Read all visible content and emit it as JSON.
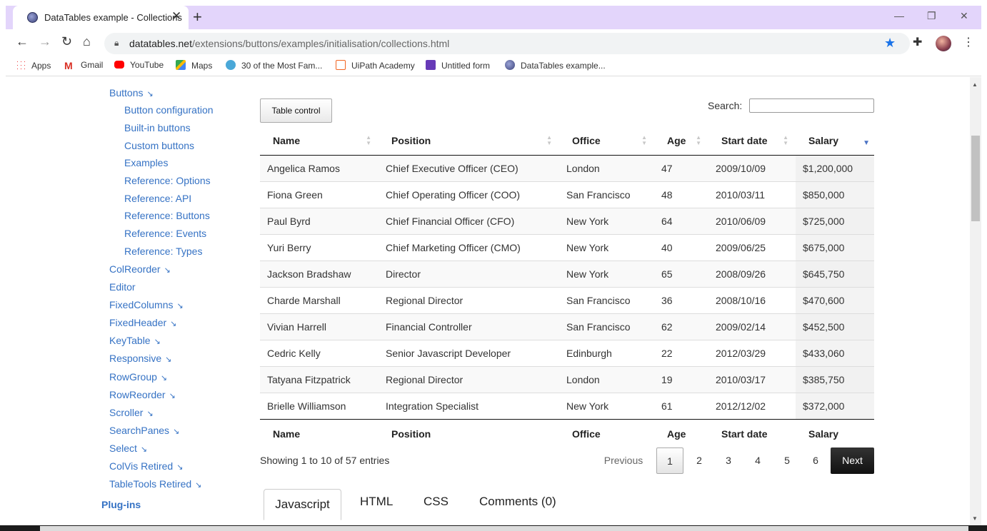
{
  "browser": {
    "tab_title": "DataTables example - Collections",
    "tab_close": "✕",
    "new_tab": "+",
    "url_host": "datatables.net",
    "url_path": "/extensions/buttons/examples/initialisation/collections.html",
    "bookmarks": [
      "Apps",
      "Gmail",
      "YouTube",
      "Maps",
      "30 of the Most Fam...",
      "UiPath Academy",
      "Untitled form",
      "DataTables example..."
    ]
  },
  "sidebar": {
    "items": [
      {
        "label": "Buttons",
        "arrow": "↘"
      },
      {
        "label": "Button configuration"
      },
      {
        "label": "Built-in buttons"
      },
      {
        "label": "Custom buttons"
      },
      {
        "label": "Examples"
      },
      {
        "label": "Reference: Options"
      },
      {
        "label": "Reference: API"
      },
      {
        "label": "Reference: Buttons"
      },
      {
        "label": "Reference: Events"
      },
      {
        "label": "Reference: Types"
      },
      {
        "label": "ColReorder",
        "arrow": "↘"
      },
      {
        "label": "Editor"
      },
      {
        "label": "FixedColumns",
        "arrow": "↘"
      },
      {
        "label": "FixedHeader",
        "arrow": "↘"
      },
      {
        "label": "KeyTable",
        "arrow": "↘"
      },
      {
        "label": "Responsive",
        "arrow": "↘"
      },
      {
        "label": "RowGroup",
        "arrow": "↘"
      },
      {
        "label": "RowReorder",
        "arrow": "↘"
      },
      {
        "label": "Scroller",
        "arrow": "↘"
      },
      {
        "label": "SearchPanes",
        "arrow": "↘"
      },
      {
        "label": "Select",
        "arrow": "↘"
      },
      {
        "label": "ColVis Retired",
        "arrow": "↘"
      },
      {
        "label": "TableTools Retired",
        "arrow": "↘"
      }
    ],
    "plugins_heading": "Plug-ins"
  },
  "controls": {
    "table_control_label": "Table control",
    "search_label": "Search:",
    "search_value": ""
  },
  "table": {
    "columns": [
      "Name",
      "Position",
      "Office",
      "Age",
      "Start date",
      "Salary"
    ],
    "rows": [
      [
        "Angelica Ramos",
        "Chief Executive Officer (CEO)",
        "London",
        "47",
        "2009/10/09",
        "$1,200,000"
      ],
      [
        "Fiona Green",
        "Chief Operating Officer (COO)",
        "San Francisco",
        "48",
        "2010/03/11",
        "$850,000"
      ],
      [
        "Paul Byrd",
        "Chief Financial Officer (CFO)",
        "New York",
        "64",
        "2010/06/09",
        "$725,000"
      ],
      [
        "Yuri Berry",
        "Chief Marketing Officer (CMO)",
        "New York",
        "40",
        "2009/06/25",
        "$675,000"
      ],
      [
        "Jackson Bradshaw",
        "Director",
        "New York",
        "65",
        "2008/09/26",
        "$645,750"
      ],
      [
        "Charde Marshall",
        "Regional Director",
        "San Francisco",
        "36",
        "2008/10/16",
        "$470,600"
      ],
      [
        "Vivian Harrell",
        "Financial Controller",
        "San Francisco",
        "62",
        "2009/02/14",
        "$452,500"
      ],
      [
        "Cedric Kelly",
        "Senior Javascript Developer",
        "Edinburgh",
        "22",
        "2012/03/29",
        "$433,060"
      ],
      [
        "Tatyana Fitzpatrick",
        "Regional Director",
        "London",
        "19",
        "2010/03/17",
        "$385,750"
      ],
      [
        "Brielle Williamson",
        "Integration Specialist",
        "New York",
        "61",
        "2012/12/02",
        "$372,000"
      ]
    ],
    "sorted_column": "Salary",
    "sort_direction": "descending"
  },
  "pagination": {
    "info": "Showing 1 to 10 of 57 entries",
    "previous": "Previous",
    "pages": [
      "1",
      "2",
      "3",
      "4",
      "5",
      "6"
    ],
    "current_page": "1",
    "next": "Next"
  },
  "code_tabs": {
    "active": "Javascript",
    "others": [
      "HTML",
      "CSS",
      "Comments (0)"
    ]
  },
  "colors": {
    "link": "#3572c4",
    "tabbar": "#e3d5fb",
    "next_button": "#111111"
  }
}
